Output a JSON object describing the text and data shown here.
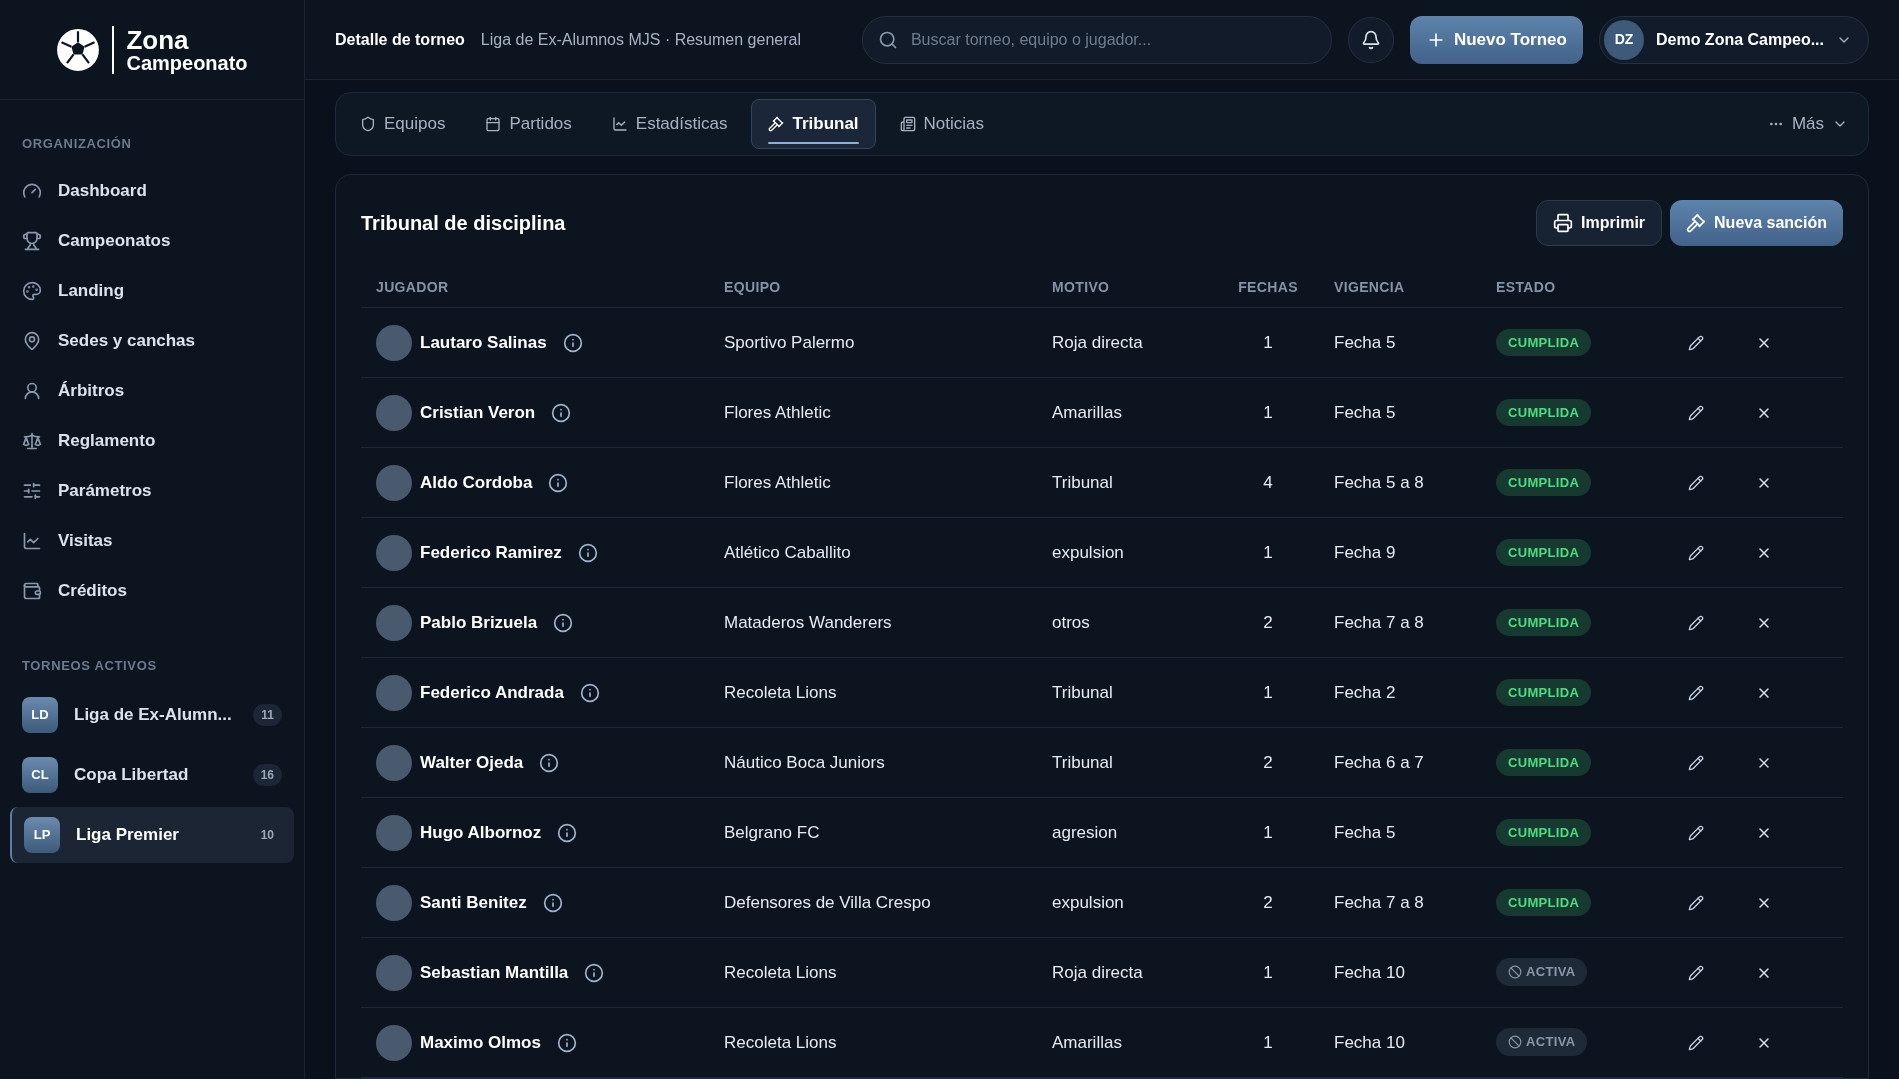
{
  "logo": {
    "line1": "Zona",
    "line2": "Campeonato"
  },
  "sidebar": {
    "sections": [
      {
        "title": "ORGANIZACIÓN",
        "items": [
          {
            "label": "Dashboard"
          },
          {
            "label": "Campeonatos"
          },
          {
            "label": "Landing"
          },
          {
            "label": "Sedes y canchas"
          },
          {
            "label": "Árbitros"
          },
          {
            "label": "Reglamento"
          },
          {
            "label": "Parámetros"
          },
          {
            "label": "Visitas"
          },
          {
            "label": "Créditos"
          }
        ]
      }
    ],
    "tournaments_title": "TORNEOS ACTIVOS",
    "tournaments": [
      {
        "initials": "LD",
        "name": "Liga de Ex-Alumn...",
        "count": "11",
        "selected": false
      },
      {
        "initials": "CL",
        "name": "Copa Libertad",
        "count": "16",
        "selected": false
      },
      {
        "initials": "LP",
        "name": "Liga Premier",
        "count": "10",
        "selected": true
      }
    ]
  },
  "header": {
    "title": "Detalle de torneo",
    "subtitle": "Liga de Ex-Alumnos MJS · Resumen general",
    "search": {
      "placeholder": "Buscar torneo, equipo o jugador..."
    },
    "new_button": "Nuevo Torneo",
    "user": {
      "initials": "DZ",
      "name": "Demo Zona Campeo..."
    }
  },
  "tabs": [
    {
      "label": "Equipos",
      "selected": false
    },
    {
      "label": "Partidos",
      "selected": false
    },
    {
      "label": "Estadísticas",
      "selected": false
    },
    {
      "label": "Tribunal",
      "selected": true
    },
    {
      "label": "Noticias",
      "selected": false
    }
  ],
  "more": "Más",
  "panel": {
    "title": "Tribunal de disciplina",
    "print_button": "Imprimir",
    "new_button": "Nueva sanción",
    "columns": [
      "JUGADOR",
      "EQUIPO",
      "MOTIVO",
      "FECHAS",
      "VIGENCIA",
      "ESTADO"
    ],
    "rows": [
      {
        "player": "Lautaro Salinas",
        "team": "Sportivo Palermo",
        "reason": "Roja directa",
        "dates": "1",
        "validity": "Fecha 5",
        "status": {
          "label": "CUMPLIDA",
          "kind": "done"
        }
      },
      {
        "player": "Cristian Veron",
        "team": "Flores Athletic",
        "reason": "Amarillas",
        "dates": "1",
        "validity": "Fecha 5",
        "status": {
          "label": "CUMPLIDA",
          "kind": "done"
        }
      },
      {
        "player": "Aldo Cordoba",
        "team": "Flores Athletic",
        "reason": "Tribunal",
        "dates": "4",
        "validity": "Fecha 5 a 8",
        "status": {
          "label": "CUMPLIDA",
          "kind": "done"
        }
      },
      {
        "player": "Federico Ramirez",
        "team": "Atlético Caballito",
        "reason": "expulsion",
        "dates": "1",
        "validity": "Fecha 9",
        "status": {
          "label": "CUMPLIDA",
          "kind": "done"
        }
      },
      {
        "player": "Pablo Brizuela",
        "team": "Mataderos Wanderers",
        "reason": "otros",
        "dates": "2",
        "validity": "Fecha 7 a 8",
        "status": {
          "label": "CUMPLIDA",
          "kind": "done"
        }
      },
      {
        "player": "Federico Andrada",
        "team": "Recoleta Lions",
        "reason": "Tribunal",
        "dates": "1",
        "validity": "Fecha 2",
        "status": {
          "label": "CUMPLIDA",
          "kind": "done"
        }
      },
      {
        "player": "Walter Ojeda",
        "team": "Náutico Boca Juniors",
        "reason": "Tribunal",
        "dates": "2",
        "validity": "Fecha 6 a 7",
        "status": {
          "label": "CUMPLIDA",
          "kind": "done"
        }
      },
      {
        "player": "Hugo Albornoz",
        "team": "Belgrano FC",
        "reason": "agresion",
        "dates": "1",
        "validity": "Fecha 5",
        "status": {
          "label": "CUMPLIDA",
          "kind": "done"
        }
      },
      {
        "player": "Santi Benitez",
        "team": "Defensores de Villa Crespo",
        "reason": "expulsion",
        "dates": "2",
        "validity": "Fecha 7 a 8",
        "status": {
          "label": "CUMPLIDA",
          "kind": "done"
        }
      },
      {
        "player": "Sebastian Mantilla",
        "team": "Recoleta Lions",
        "reason": "Roja directa",
        "dates": "1",
        "validity": "Fecha 10",
        "status": {
          "label": "ACTIVA",
          "kind": "active"
        }
      },
      {
        "player": "Maximo Olmos",
        "team": "Recoleta Lions",
        "reason": "Amarillas",
        "dates": "1",
        "validity": "Fecha 10",
        "status": {
          "label": "ACTIVA",
          "kind": "active"
        }
      }
    ]
  }
}
